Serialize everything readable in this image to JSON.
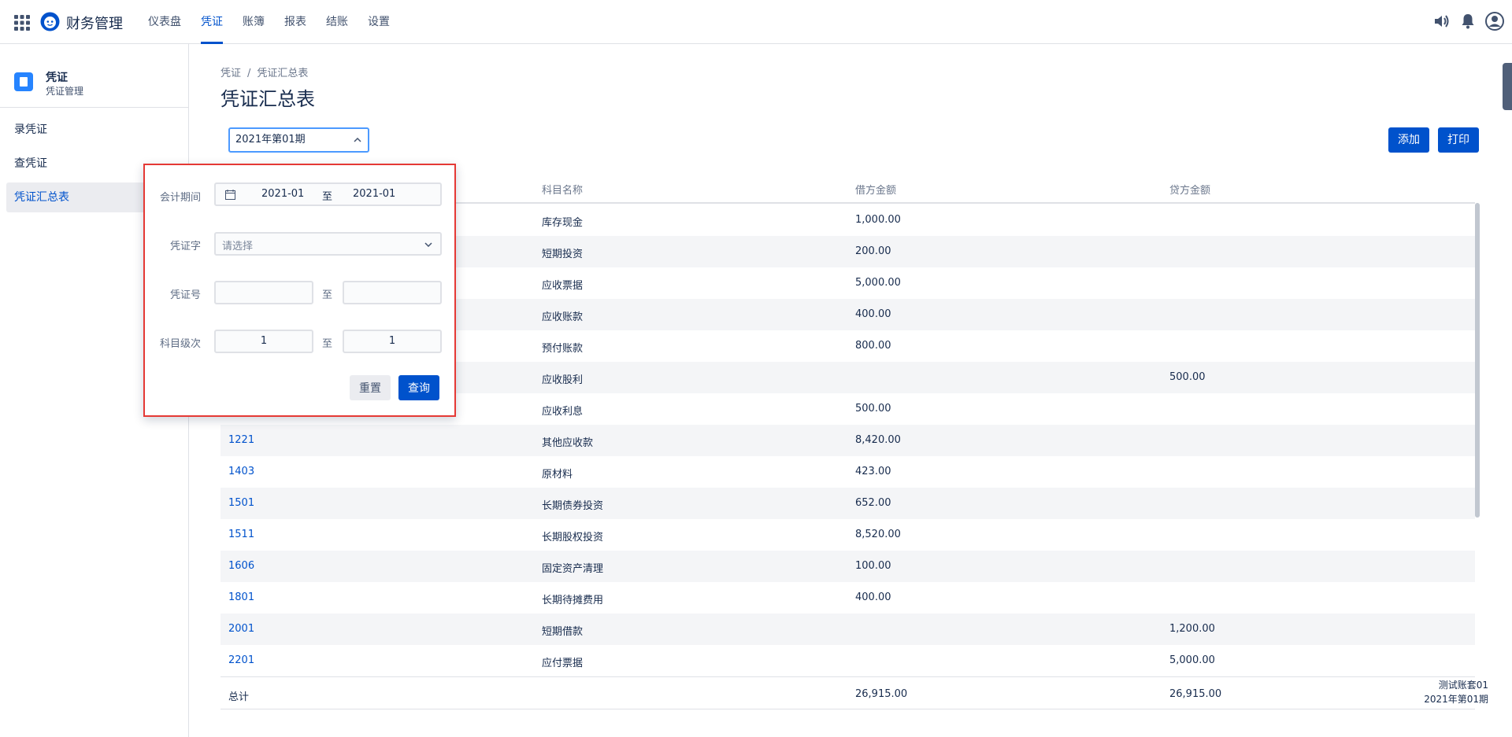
{
  "app": {
    "title": "财务管理"
  },
  "nav": [
    {
      "label": "仪表盘",
      "active": false
    },
    {
      "label": "凭证",
      "active": true
    },
    {
      "label": "账簿",
      "active": false
    },
    {
      "label": "报表",
      "active": false
    },
    {
      "label": "结账",
      "active": false
    },
    {
      "label": "设置",
      "active": false
    }
  ],
  "sidebar": {
    "title": "凭证",
    "subtitle": "凭证管理",
    "items": [
      {
        "label": "录凭证",
        "active": false
      },
      {
        "label": "查凭证",
        "active": false
      },
      {
        "label": "凭证汇总表",
        "active": true
      }
    ]
  },
  "breadcrumb": {
    "parent": "凭证",
    "separator": "/",
    "current": "凭证汇总表"
  },
  "page": {
    "title": "凭证汇总表"
  },
  "period_select": {
    "value": "2021年第01期"
  },
  "toolbar": {
    "add_label": "添加",
    "print_label": "打印"
  },
  "filter": {
    "period_label": "会计期间",
    "period_from": "2021-01",
    "period_to": "2021-01",
    "to_label": "至",
    "voucher_word_label": "凭证字",
    "voucher_word_placeholder": "请选择",
    "voucher_no_label": "凭证号",
    "voucher_no_from": "",
    "voucher_no_to": "",
    "level_label": "科目级次",
    "level_from": "1",
    "level_to": "1",
    "reset_label": "重置",
    "query_label": "查询"
  },
  "table": {
    "columns": [
      "科目名称",
      "借方金额",
      "贷方金额"
    ],
    "rows": [
      {
        "code": "",
        "name": "库存现金",
        "debit": "1,000.00",
        "credit": ""
      },
      {
        "code": "",
        "name": "短期投资",
        "debit": "200.00",
        "credit": ""
      },
      {
        "code": "",
        "name": "应收票据",
        "debit": "5,000.00",
        "credit": ""
      },
      {
        "code": "",
        "name": "应收账款",
        "debit": "400.00",
        "credit": ""
      },
      {
        "code": "",
        "name": "预付账款",
        "debit": "800.00",
        "credit": ""
      },
      {
        "code": "",
        "name": "应收股利",
        "debit": "",
        "credit": "500.00"
      },
      {
        "code": "",
        "name": "应收利息",
        "debit": "500.00",
        "credit": ""
      },
      {
        "code": "1221",
        "name": "其他应收款",
        "debit": "8,420.00",
        "credit": ""
      },
      {
        "code": "1403",
        "name": "原材料",
        "debit": "423.00",
        "credit": ""
      },
      {
        "code": "1501",
        "name": "长期债券投资",
        "debit": "652.00",
        "credit": ""
      },
      {
        "code": "1511",
        "name": "长期股权投资",
        "debit": "8,520.00",
        "credit": ""
      },
      {
        "code": "1606",
        "name": "固定资产清理",
        "debit": "100.00",
        "credit": ""
      },
      {
        "code": "1801",
        "name": "长期待摊费用",
        "debit": "400.00",
        "credit": ""
      },
      {
        "code": "2001",
        "name": "短期借款",
        "debit": "",
        "credit": "1,200.00"
      },
      {
        "code": "2201",
        "name": "应付票据",
        "debit": "",
        "credit": "5,000.00"
      }
    ],
    "total": {
      "label": "总计",
      "debit": "26,915.00",
      "credit": "26,915.00"
    }
  },
  "book_info": {
    "name": "测试账套01",
    "period": "2021年第01期"
  }
}
